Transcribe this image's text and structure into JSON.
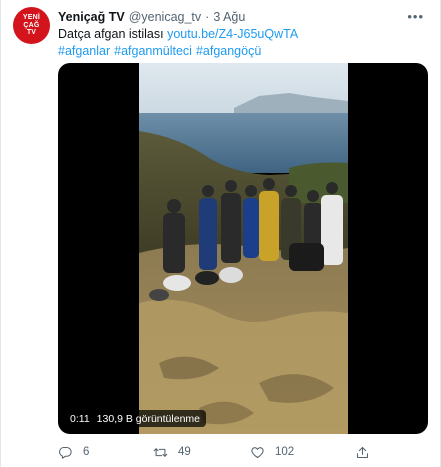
{
  "account": {
    "avatar_line1": "YENİ",
    "avatar_line2": "ÇAĞ",
    "avatar_line3": "TV",
    "name": "Yeniçağ TV",
    "handle": "@yenicag_tv",
    "separator": "·",
    "date": "3 Ağu"
  },
  "tweet": {
    "text": "Datça afgan istilası",
    "link": "youtu.be/Z4-J65uQwTA",
    "hashtags": [
      "#afganlar",
      "#afganmülteci",
      "#afgangöçü"
    ]
  },
  "video": {
    "time": "0:11",
    "views": "130,9 B görüntülenme"
  },
  "actions": {
    "replies": "6",
    "retweets": "49",
    "likes": "102"
  },
  "icons": {
    "more": "more-icon",
    "reply": "reply-icon",
    "retweet": "retweet-icon",
    "like": "heart-icon",
    "share": "share-icon"
  },
  "colors": {
    "link": "#1d9bf0",
    "avatar_bg": "#d4141c",
    "muted": "#536471"
  }
}
